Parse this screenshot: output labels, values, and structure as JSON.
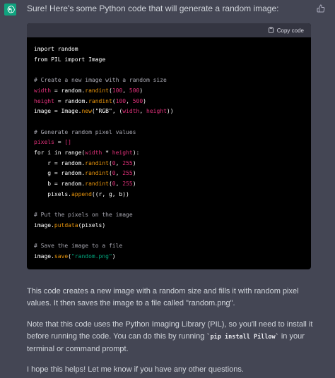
{
  "message": {
    "intro": "Sure! Here's some Python code that will generate a random image:",
    "avatar_icon": "openai-logo-icon",
    "avatar_color": "#10a37f",
    "feedback_icon": "thumbs-up-icon"
  },
  "code_block": {
    "copy_label": "Copy code",
    "copy_icon": "clipboard-icon",
    "lines": [
      [
        {
          "t": "import random",
          "k": "plain"
        }
      ],
      [
        {
          "t": "from PIL import Image",
          "k": "plain"
        }
      ],
      [],
      [
        {
          "t": "# Create a new image with a random size",
          "k": "comment"
        }
      ],
      [
        {
          "t": "width",
          "k": "var"
        },
        {
          "t": " = random.",
          "k": "plain"
        },
        {
          "t": "randint",
          "k": "builtin"
        },
        {
          "t": "(",
          "k": "plain"
        },
        {
          "t": "100",
          "k": "num"
        },
        {
          "t": ", ",
          "k": "plain"
        },
        {
          "t": "500",
          "k": "num"
        },
        {
          "t": ")",
          "k": "plain"
        }
      ],
      [
        {
          "t": "height",
          "k": "var"
        },
        {
          "t": " = random.",
          "k": "plain"
        },
        {
          "t": "randint",
          "k": "builtin"
        },
        {
          "t": "(",
          "k": "plain"
        },
        {
          "t": "100",
          "k": "num"
        },
        {
          "t": ", ",
          "k": "plain"
        },
        {
          "t": "500",
          "k": "num"
        },
        {
          "t": ")",
          "k": "plain"
        }
      ],
      [
        {
          "t": "image = Image.",
          "k": "plain"
        },
        {
          "t": "new",
          "k": "builtin"
        },
        {
          "t": "(",
          "k": "plain"
        },
        {
          "t": "\"RGB\"",
          "k": "plain"
        },
        {
          "t": ", (",
          "k": "plain"
        },
        {
          "t": "width",
          "k": "var"
        },
        {
          "t": ", ",
          "k": "plain"
        },
        {
          "t": "height",
          "k": "var"
        },
        {
          "t": "))",
          "k": "plain"
        }
      ],
      [],
      [
        {
          "t": "# Generate random pixel values",
          "k": "comment"
        }
      ],
      [
        {
          "t": "pixels",
          "k": "var"
        },
        {
          "t": " = ",
          "k": "plain"
        },
        {
          "t": "[]",
          "k": "var"
        }
      ],
      [
        {
          "t": "for i in range(",
          "k": "plain"
        },
        {
          "t": "width",
          "k": "var"
        },
        {
          "t": " * ",
          "k": "plain"
        },
        {
          "t": "height",
          "k": "var"
        },
        {
          "t": "):",
          "k": "plain"
        }
      ],
      [
        {
          "t": "    r = random.",
          "k": "plain"
        },
        {
          "t": "randint",
          "k": "builtin"
        },
        {
          "t": "(",
          "k": "plain"
        },
        {
          "t": "0",
          "k": "num"
        },
        {
          "t": ", ",
          "k": "plain"
        },
        {
          "t": "255",
          "k": "num"
        },
        {
          "t": ")",
          "k": "plain"
        }
      ],
      [
        {
          "t": "    g = random.",
          "k": "plain"
        },
        {
          "t": "randint",
          "k": "builtin"
        },
        {
          "t": "(",
          "k": "plain"
        },
        {
          "t": "0",
          "k": "num"
        },
        {
          "t": ", ",
          "k": "plain"
        },
        {
          "t": "255",
          "k": "num"
        },
        {
          "t": ")",
          "k": "plain"
        }
      ],
      [
        {
          "t": "    b = random.",
          "k": "plain"
        },
        {
          "t": "randint",
          "k": "builtin"
        },
        {
          "t": "(",
          "k": "plain"
        },
        {
          "t": "0",
          "k": "num"
        },
        {
          "t": ", ",
          "k": "plain"
        },
        {
          "t": "255",
          "k": "num"
        },
        {
          "t": ")",
          "k": "plain"
        }
      ],
      [
        {
          "t": "    pixels.",
          "k": "plain"
        },
        {
          "t": "append",
          "k": "builtin"
        },
        {
          "t": "((r, g, b))",
          "k": "plain"
        }
      ],
      [],
      [
        {
          "t": "# Put the pixels on the image",
          "k": "comment"
        }
      ],
      [
        {
          "t": "image.",
          "k": "plain"
        },
        {
          "t": "putdata",
          "k": "builtin"
        },
        {
          "t": "(pixels)",
          "k": "plain"
        }
      ],
      [],
      [
        {
          "t": "# Save the image to a file",
          "k": "comment"
        }
      ],
      [
        {
          "t": "image.",
          "k": "plain"
        },
        {
          "t": "save",
          "k": "builtin"
        },
        {
          "t": "(",
          "k": "plain"
        },
        {
          "t": "\"random.png\"",
          "k": "str"
        },
        {
          "t": ")",
          "k": "plain"
        }
      ]
    ]
  },
  "paragraphs": {
    "p1": "This code creates a new image with a random size and fills it with random pixel values. It then saves the image to a file called \"random.png\".",
    "p2_before": "Note that this code uses the Python Imaging Library (PIL), so you'll need to install it before running the code. You can do this by running ",
    "p2_code": "`pip install Pillow`",
    "p2_after": " in your terminal or command prompt.",
    "p3": "I hope this helps! Let me know if you have any other questions."
  },
  "colors": {
    "background": "#444654",
    "code_background": "#000000",
    "code_header": "#343541",
    "text": "#d1d5db"
  }
}
